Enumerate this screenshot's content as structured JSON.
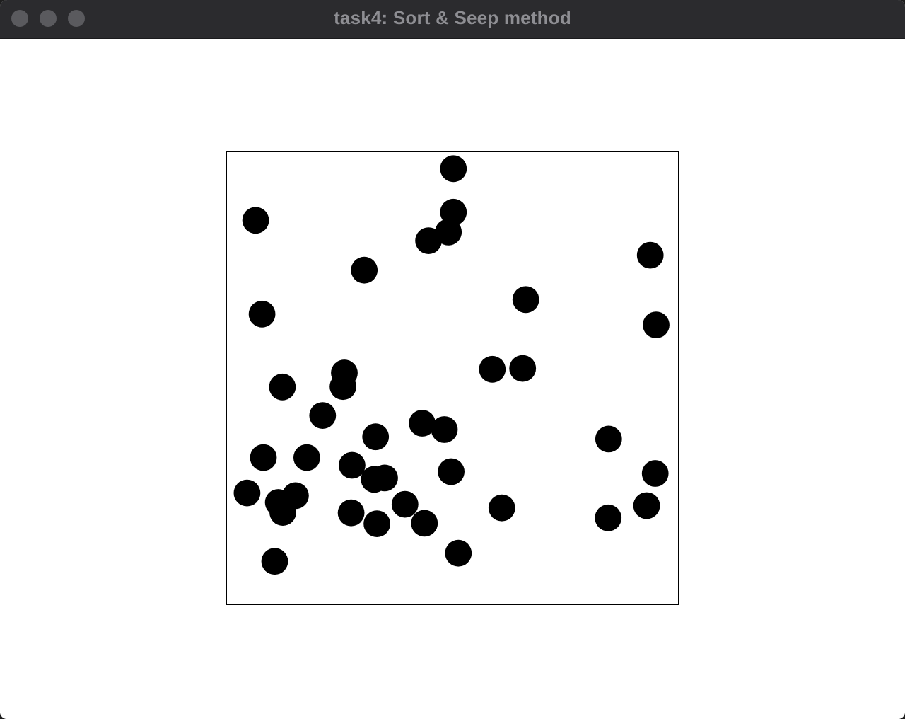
{
  "window": {
    "title": "task4: Sort & Seep method",
    "controls": [
      "close",
      "minimize",
      "zoom"
    ],
    "titlebar_color": "#2b2b2e",
    "control_color": "#5a5a5e"
  },
  "scene": {
    "domain": [
      0,
      1
    ],
    "box_stroke": "#000000",
    "ball_color": "#000000",
    "ball_radius": 0.0295,
    "balls": [
      [
        0.502,
        0.962
      ],
      [
        0.065,
        0.848
      ],
      [
        0.502,
        0.866
      ],
      [
        0.491,
        0.822
      ],
      [
        0.447,
        0.803
      ],
      [
        0.305,
        0.738
      ],
      [
        0.937,
        0.771
      ],
      [
        0.079,
        0.641
      ],
      [
        0.662,
        0.673
      ],
      [
        0.95,
        0.617
      ],
      [
        0.261,
        0.511
      ],
      [
        0.258,
        0.481
      ],
      [
        0.124,
        0.48
      ],
      [
        0.588,
        0.519
      ],
      [
        0.655,
        0.521
      ],
      [
        0.213,
        0.417
      ],
      [
        0.433,
        0.4
      ],
      [
        0.482,
        0.386
      ],
      [
        0.33,
        0.37
      ],
      [
        0.845,
        0.365
      ],
      [
        0.082,
        0.324
      ],
      [
        0.178,
        0.324
      ],
      [
        0.278,
        0.307
      ],
      [
        0.497,
        0.293
      ],
      [
        0.327,
        0.276
      ],
      [
        0.35,
        0.279
      ],
      [
        0.948,
        0.289
      ],
      [
        0.046,
        0.246
      ],
      [
        0.115,
        0.225
      ],
      [
        0.153,
        0.24
      ],
      [
        0.125,
        0.203
      ],
      [
        0.276,
        0.202
      ],
      [
        0.395,
        0.221
      ],
      [
        0.333,
        0.178
      ],
      [
        0.438,
        0.179
      ],
      [
        0.609,
        0.213
      ],
      [
        0.844,
        0.191
      ],
      [
        0.929,
        0.218
      ],
      [
        0.513,
        0.113
      ],
      [
        0.107,
        0.095
      ]
    ]
  }
}
